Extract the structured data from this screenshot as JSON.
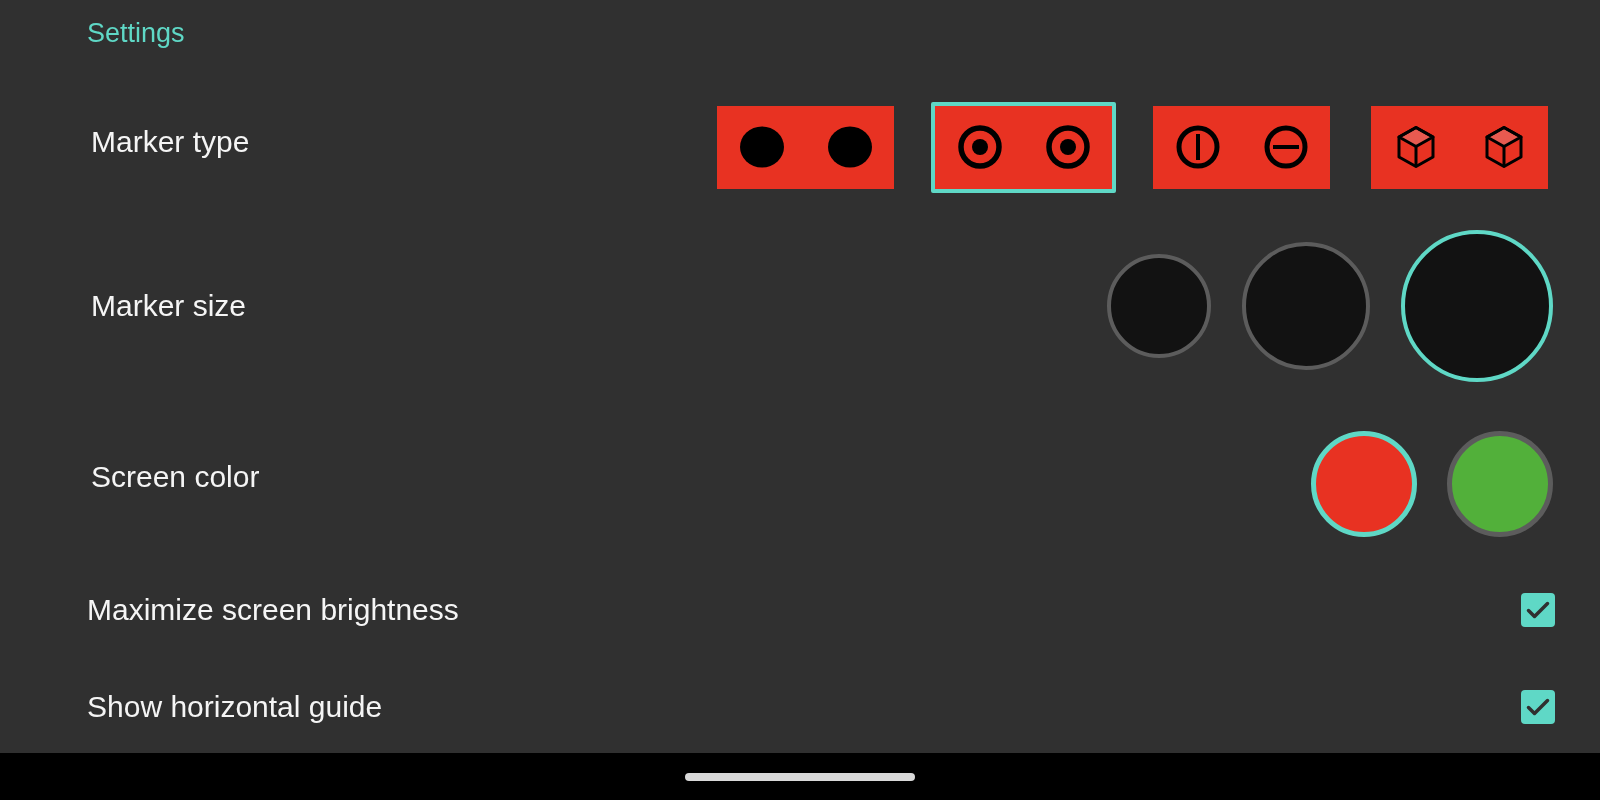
{
  "header": {
    "title": "Settings"
  },
  "marker_type": {
    "label": "Marker type",
    "options": [
      {
        "selected": false,
        "glyphs": [
          {
            "kind": "dot"
          },
          {
            "kind": "dot"
          }
        ]
      },
      {
        "selected": true,
        "glyphs": [
          {
            "kind": "ring"
          },
          {
            "kind": "ring"
          }
        ]
      },
      {
        "selected": false,
        "glyphs": [
          {
            "kind": "circle-vertical-bar"
          },
          {
            "kind": "circle-horizontal-bar"
          }
        ]
      },
      {
        "selected": false,
        "glyphs": [
          {
            "kind": "cube"
          },
          {
            "kind": "cube"
          }
        ]
      }
    ]
  },
  "marker_size": {
    "label": "Marker size",
    "options": [
      {
        "kind": "small",
        "selected": false
      },
      {
        "kind": "medium",
        "selected": false
      },
      {
        "kind": "large",
        "selected": true
      }
    ]
  },
  "screen_color": {
    "label": "Screen color",
    "options": [
      {
        "color": "#e83222",
        "selected": true
      },
      {
        "color": "#52b03a",
        "selected": false
      }
    ]
  },
  "toggles": [
    {
      "label": "Maximize screen brightness",
      "checked": true
    },
    {
      "label": "Show horizontal guide",
      "checked": true
    }
  ]
}
